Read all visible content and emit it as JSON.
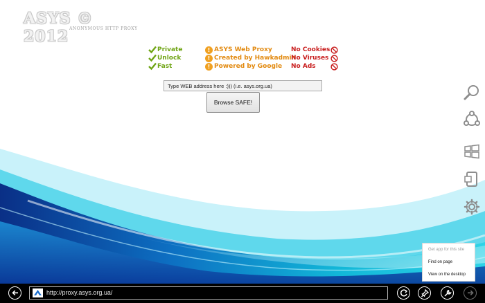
{
  "logo": {
    "title": "ASYS © 2012",
    "subtitle": "Anonymous HTTP Proxy"
  },
  "features": {
    "green": [
      "Private",
      "Unlock",
      "Fast"
    ],
    "orange": [
      "ASYS Web Proxy",
      "Created by Hawkadmin",
      "Powered by Google"
    ],
    "red": [
      "No Cookies",
      "No Viruses",
      "No Ads"
    ]
  },
  "search": {
    "placeholder": "Type WEB address here :))) (i.e. asys.org.ua)",
    "value": "Type WEB address here :))) (i.e. asys.org.ua)"
  },
  "browse_button": "Browse SAFE!",
  "charms": [
    "search-icon",
    "share-icon",
    "start-icon",
    "devices-icon",
    "settings-icon"
  ],
  "popup": [
    "Get app for this site",
    "Find on page",
    "View on the desktop"
  ],
  "addressbar": {
    "url": "http://proxy.asys.org.ua/"
  },
  "colors": {
    "accent_green": "#6fa414",
    "accent_orange": "#e28a10",
    "accent_red": "#c92020",
    "appbar": "#000000"
  }
}
